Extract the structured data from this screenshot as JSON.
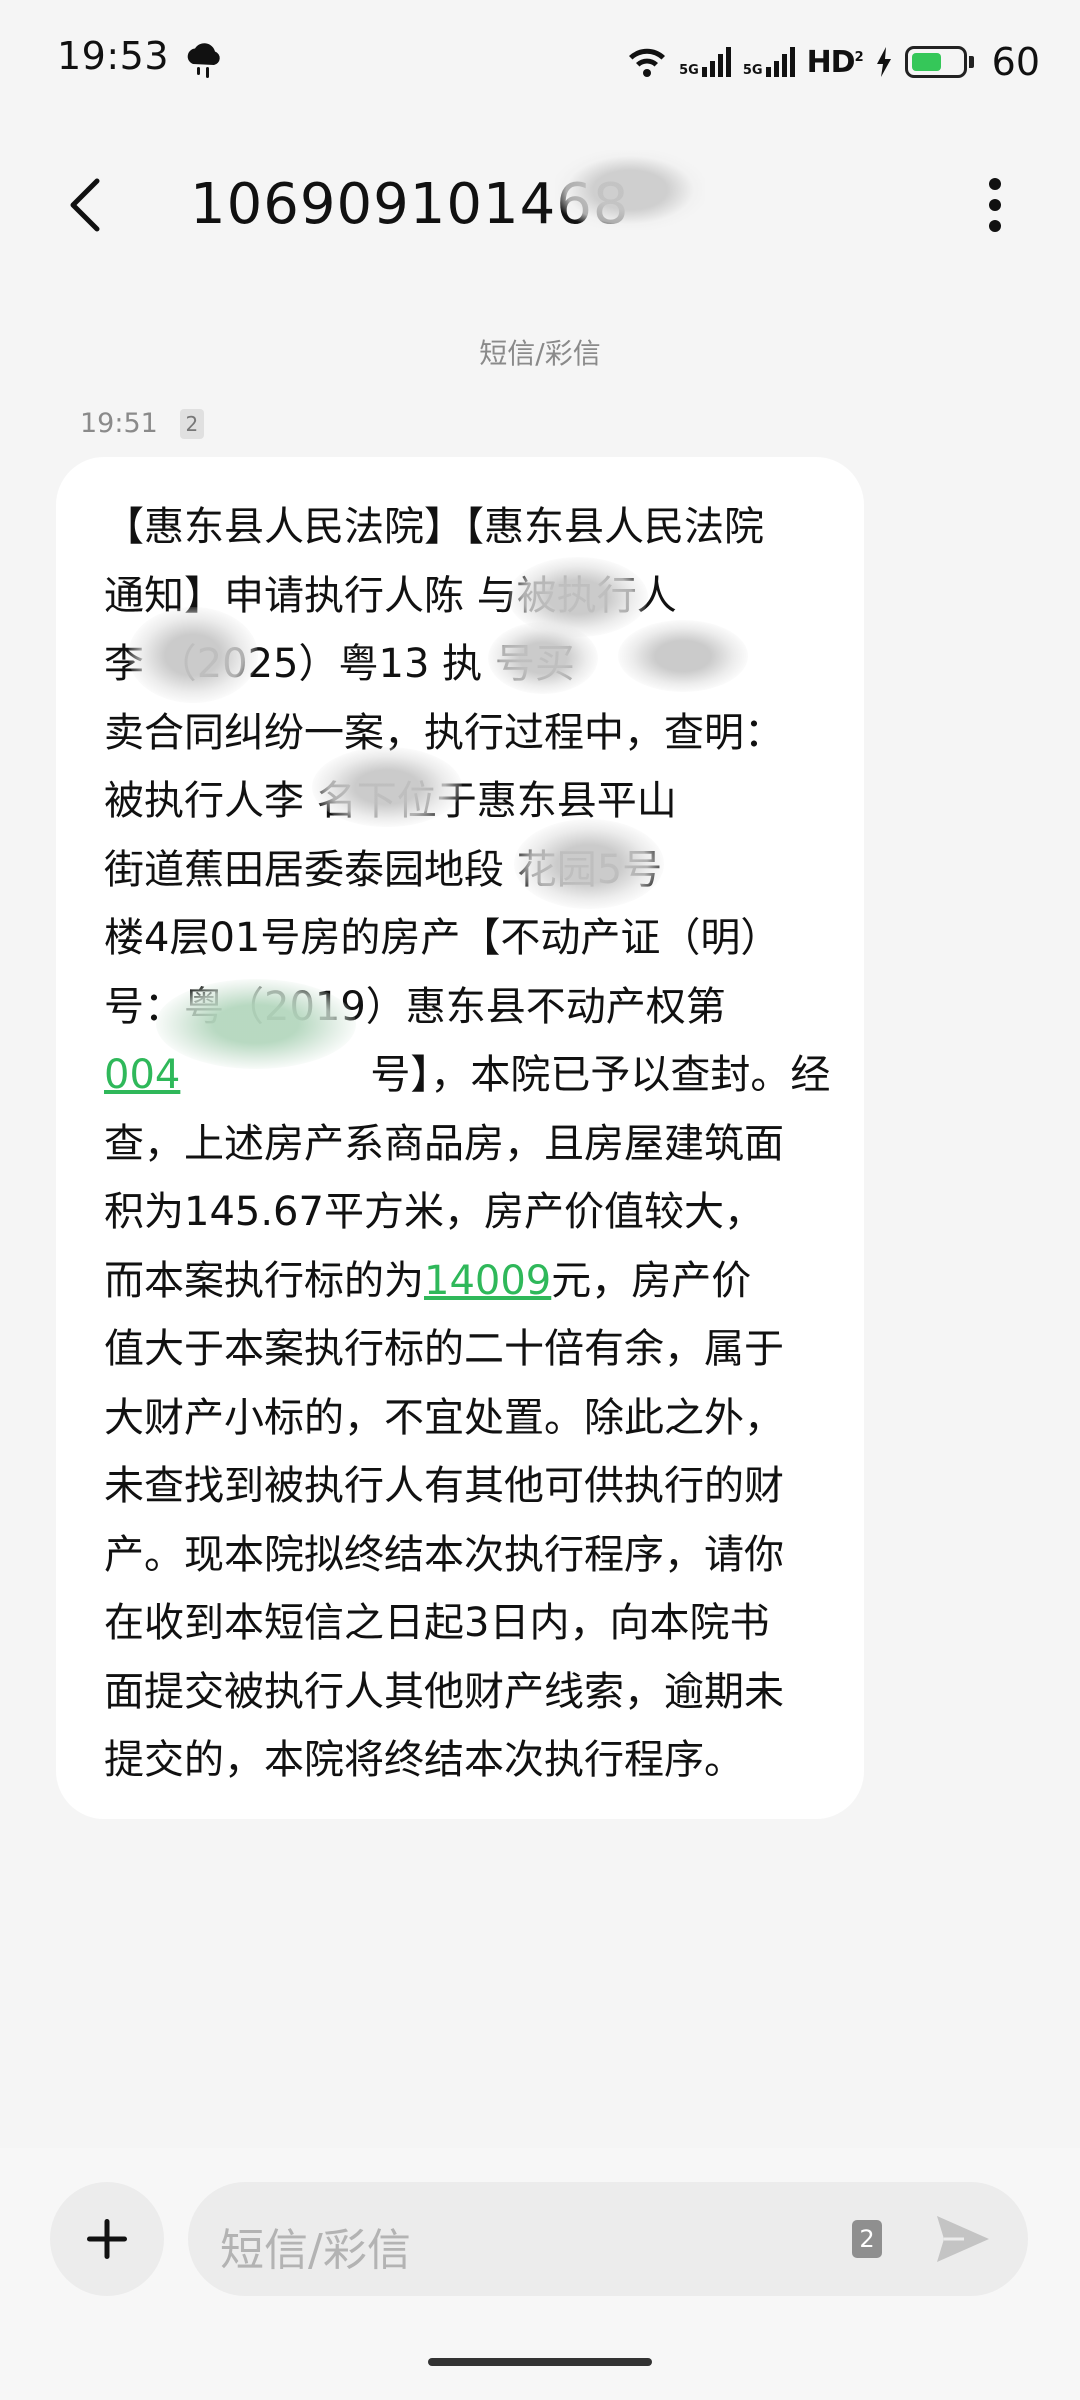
{
  "status_bar": {
    "time": "19:53",
    "weather_icon": "cloud-rain-icon",
    "net_1": "5G",
    "net_2": "5G",
    "hd_label": "HD",
    "hd_sub": "2",
    "battery_level": "60",
    "battery_fraction": 0.6,
    "battery_color": "#35c759"
  },
  "header": {
    "contact_number": "10690910146",
    "contact_number_obscured_part": "8",
    "back_icon": "chevron-left-icon",
    "more_icon": "more-vertical-icon"
  },
  "conversation": {
    "channel_label": "短信/彩信",
    "message": {
      "time": "19:51",
      "sim_slot": "2",
      "lines": [
        "【惠东县人民法院】【惠东县人民法院",
        "通知】申请执行人陈        与被执行人",
        "李        （2025）粤13        执          号买",
        "卖合同纠纷一案，执行过程中，查明：",
        "被执行人李        名下位于惠东县平山",
        "街道蕉田居委泰园地段          花园5号",
        "楼4层01号房的房产【不动产证（明）",
        "号：粤（2019）惠东县不动产权第",
        "号】，本院已予以查封。经",
        "查，上述房产系商品房，且房屋建筑面",
        "积为145.67平方米，房产价值较大，",
        "而本案执行标的为",
        "值大于本案执行标的二十倍有余，属于",
        "大财产小标的，不宜处置。除此之外，",
        "未查找到被执行人有其他可供执行的财",
        "产。现本院拟终结本次执行程序，请你",
        "在收到本短信之日起3日内，向本院书",
        "面提交被执行人其他财产线索，逾期未",
        "提交的，本院将终结本次执行程序。"
      ],
      "link_cert_no": "004",
      "link_amount": "14009",
      "line_12_suffix": "元，房产价"
    }
  },
  "composer": {
    "add_icon": "plus-icon",
    "placeholder": "短信/彩信",
    "sim_slot": "2",
    "send_icon": "send-icon"
  },
  "colors": {
    "link": "#2fb85a",
    "background": "#f5f5f5",
    "bubble": "#ffffff",
    "muted_text": "#8a8a8a"
  }
}
